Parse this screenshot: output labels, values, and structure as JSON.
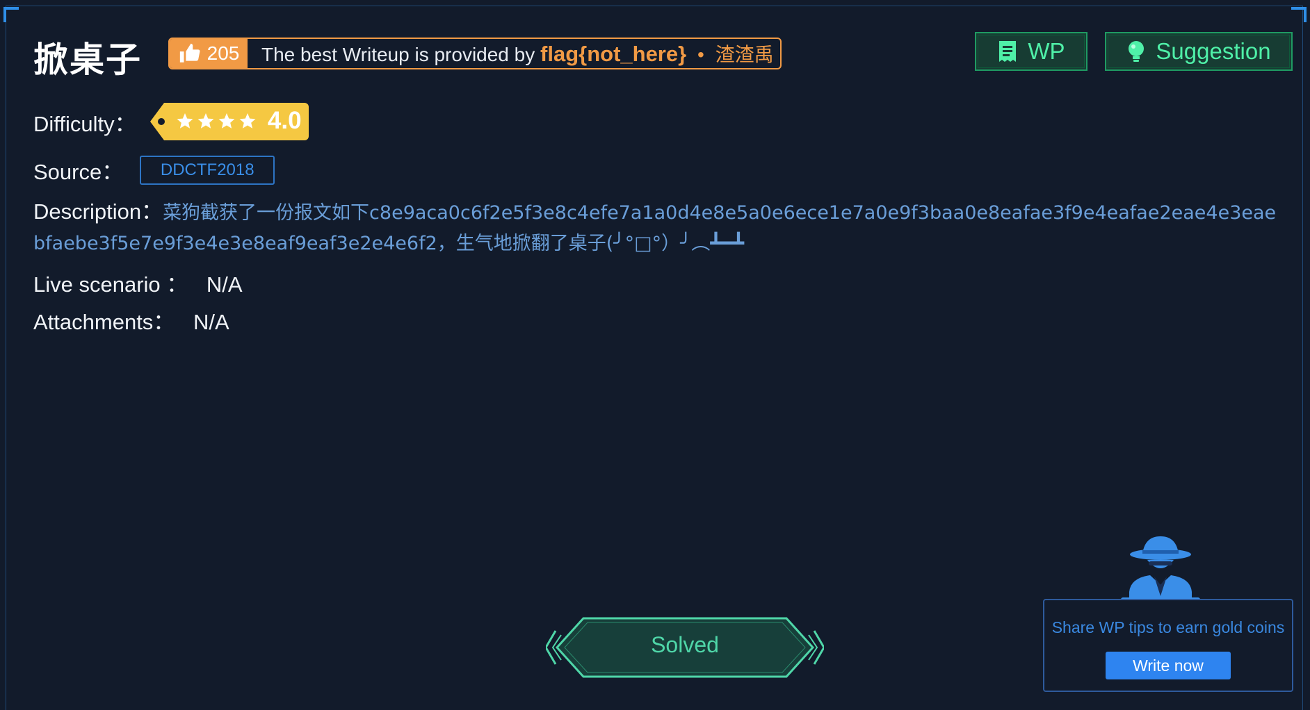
{
  "challenge": {
    "title": "掀桌子",
    "likes": "205",
    "writeup_prefix": "The best Writeup is provided by",
    "writeup_user": "flag{not_here}",
    "writeup_separator": "•",
    "writeup_author": "渣渣禹"
  },
  "buttons": {
    "wp_label": "WP",
    "suggestion_label": "Suggestion"
  },
  "difficulty": {
    "label": "Difficulty：",
    "stars": 4,
    "value": "4.0"
  },
  "source": {
    "label": "Source：",
    "value": "DDCTF2018"
  },
  "description": {
    "label": "Description：",
    "text": "菜狗截获了一份报文如下c8e9aca0c6f2e5f3e8c4efe7a1a0d4e8e5a0e6ece1e7a0e9f3baa0e8eafae3f9e4eafae2eae4e3eaebfaebe3f5e7e9f3e4e3e8eaf9eaf3e2e4e6f2，生气地掀翻了桌子(╯°□°）╯︵┻━┻"
  },
  "live_scenario": {
    "label": "Live scenario ：",
    "value": "N/A"
  },
  "attachments": {
    "label": "Attachments：",
    "value": "N/A"
  },
  "status": {
    "label": "Solved"
  },
  "wp_promo": {
    "tip": "Share WP tips to earn gold coins",
    "button": "Write now"
  },
  "colors": {
    "background": "#121b2b",
    "accent_orange": "#f19a45",
    "accent_green": "#4ff0a8",
    "accent_blue": "#2e84f0",
    "difficulty_yellow": "#f5c842"
  }
}
